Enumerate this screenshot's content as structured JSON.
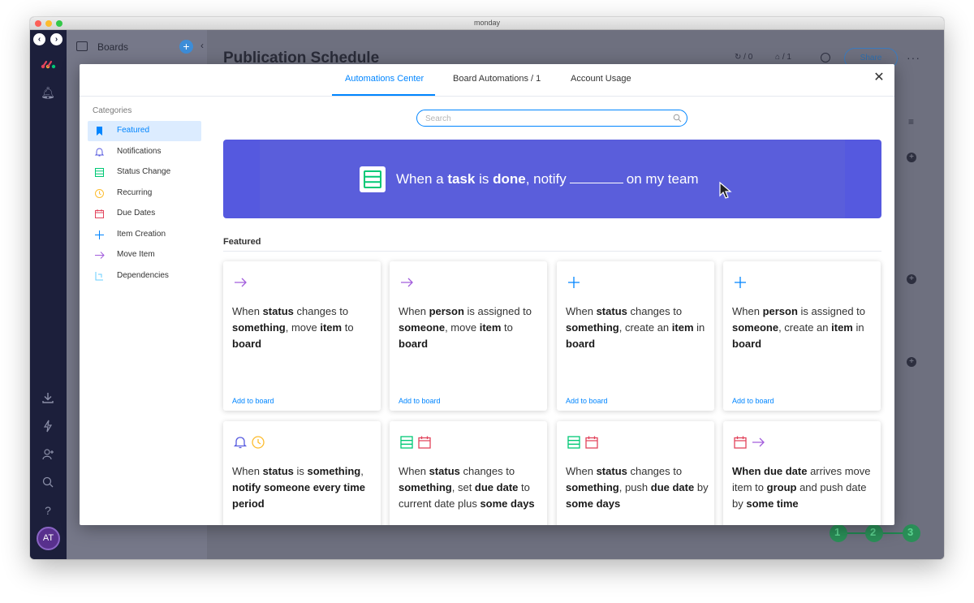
{
  "window": {
    "title": "monday"
  },
  "leftbar": {
    "avatar_initials": "AT",
    "icons": [
      "bell-icon",
      "download-icon",
      "lightning-icon",
      "add-user-icon",
      "search-icon",
      "help-icon"
    ]
  },
  "boards_panel": {
    "title": "Boards"
  },
  "board": {
    "title": "Publication Schedule",
    "share_label": "Share",
    "activity_count": "/ 0",
    "members_count": "/ 1",
    "progress_steps": [
      "1",
      "2",
      "3"
    ]
  },
  "modal": {
    "tabs": [
      {
        "label": "Automations Center",
        "active": true
      },
      {
        "label": "Board Automations / 1",
        "active": false
      },
      {
        "label": "Account Usage",
        "active": false
      }
    ],
    "categories_header": "Categories",
    "categories": [
      {
        "label": "Featured",
        "icon": "bookmark-icon",
        "color": "#0085ff",
        "selected": true
      },
      {
        "label": "Notifications",
        "icon": "bell-icon",
        "color": "#5559df",
        "selected": false
      },
      {
        "label": "Status Change",
        "icon": "status-icon",
        "color": "#00c875",
        "selected": false
      },
      {
        "label": "Recurring",
        "icon": "clock-icon",
        "color": "#fdbc2e",
        "selected": false
      },
      {
        "label": "Due Dates",
        "icon": "calendar-icon",
        "color": "#e2445c",
        "selected": false
      },
      {
        "label": "Item Creation",
        "icon": "plus-icon",
        "color": "#0085ff",
        "selected": false
      },
      {
        "label": "Move Item",
        "icon": "arrow-right-icon",
        "color": "#a25ddc",
        "selected": false
      },
      {
        "label": "Dependencies",
        "icon": "dependency-icon",
        "color": "#66ccff",
        "selected": false
      }
    ],
    "search": {
      "placeholder": "Search",
      "value": ""
    },
    "banner": {
      "text_when": "When a ",
      "text_task": "task",
      "text_is": " is ",
      "text_done": "done",
      "text_notify": ", notify",
      "text_end": "on my team"
    },
    "featured_heading": "Featured",
    "recipes": [
      {
        "icons": [
          "arrow-right-icon"
        ],
        "segments": [
          [
            "When ",
            false
          ],
          [
            "status",
            true
          ],
          [
            " changes to ",
            false
          ],
          [
            "something",
            true
          ],
          [
            ", move ",
            false
          ],
          [
            "item",
            true
          ],
          [
            " to ",
            false
          ],
          [
            "board",
            true
          ]
        ],
        "link": "Add to board"
      },
      {
        "icons": [
          "arrow-right-icon"
        ],
        "segments": [
          [
            "When ",
            false
          ],
          [
            "person",
            true
          ],
          [
            " is assigned to ",
            false
          ],
          [
            "someone",
            true
          ],
          [
            ", move ",
            false
          ],
          [
            "item",
            true
          ],
          [
            " to ",
            false
          ],
          [
            "board",
            true
          ]
        ],
        "link": "Add to board"
      },
      {
        "icons": [
          "plus-icon"
        ],
        "segments": [
          [
            "When ",
            false
          ],
          [
            "status",
            true
          ],
          [
            " changes to ",
            false
          ],
          [
            "something",
            true
          ],
          [
            ", create an ",
            false
          ],
          [
            "item",
            true
          ],
          [
            " in ",
            false
          ],
          [
            "board",
            true
          ]
        ],
        "link": "Add to board"
      },
      {
        "icons": [
          "plus-icon"
        ],
        "segments": [
          [
            "When ",
            false
          ],
          [
            "person",
            true
          ],
          [
            " is assigned to ",
            false
          ],
          [
            "someone",
            true
          ],
          [
            ", create an ",
            false
          ],
          [
            "item",
            true
          ],
          [
            " in ",
            false
          ],
          [
            "board",
            true
          ]
        ],
        "link": "Add to board"
      },
      {
        "icons": [
          "bell-icon",
          "clock-icon"
        ],
        "segments": [
          [
            "When ",
            false
          ],
          [
            "status",
            true
          ],
          [
            " is ",
            false
          ],
          [
            "something",
            true
          ],
          [
            ", ",
            false
          ],
          [
            "notify someone",
            true
          ],
          [
            " ",
            false
          ],
          [
            "every time period",
            true
          ]
        ],
        "link": ""
      },
      {
        "icons": [
          "status-icon",
          "calendar-icon"
        ],
        "segments": [
          [
            "When ",
            false
          ],
          [
            "status",
            true
          ],
          [
            " changes to ",
            false
          ],
          [
            "something",
            true
          ],
          [
            ", set ",
            false
          ],
          [
            "due date",
            true
          ],
          [
            " to current date plus ",
            false
          ],
          [
            "some days",
            true
          ]
        ],
        "link": ""
      },
      {
        "icons": [
          "status-icon",
          "calendar-icon"
        ],
        "segments": [
          [
            "When ",
            false
          ],
          [
            "status",
            true
          ],
          [
            " changes to ",
            false
          ],
          [
            "something",
            true
          ],
          [
            ", push ",
            false
          ],
          [
            "due date",
            true
          ],
          [
            " by ",
            false
          ],
          [
            "some days",
            true
          ]
        ],
        "link": ""
      },
      {
        "icons": [
          "calendar-icon",
          "arrow-right-icon"
        ],
        "segments": [
          [
            "When ",
            true
          ],
          [
            "due date",
            true
          ],
          [
            " arrives move item to ",
            false
          ],
          [
            "group",
            true
          ],
          [
            " and push date by ",
            false
          ],
          [
            "some time",
            true
          ]
        ],
        "link": ""
      }
    ]
  },
  "colors": {
    "accent": "#0085ff",
    "banner": "#5559df",
    "sidebar": "#1c1f3b",
    "status_green": "#00c875",
    "recurring_yellow": "#fdbc2e",
    "due_red": "#e2445c",
    "move_purple": "#a25ddc",
    "notify_indigo": "#5559df"
  }
}
